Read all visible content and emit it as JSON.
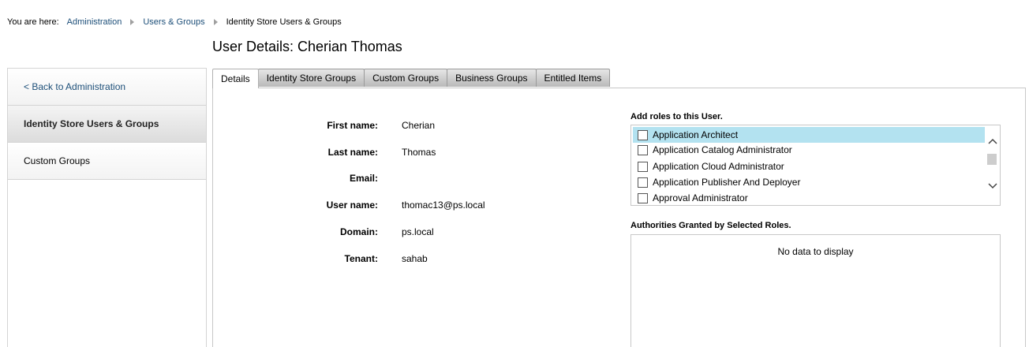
{
  "breadcrumb": {
    "prefix": "You are here:",
    "items": [
      "Administration",
      "Users & Groups"
    ],
    "current": "Identity Store Users & Groups"
  },
  "page_title": "User Details: Cherian Thomas",
  "sidebar": {
    "items": [
      {
        "label": "< Back to Administration"
      },
      {
        "label": "Identity Store Users & Groups"
      },
      {
        "label": "Custom Groups"
      }
    ]
  },
  "tabs": [
    "Details",
    "Identity Store Groups",
    "Custom Groups",
    "Business Groups",
    "Entitled Items"
  ],
  "details": {
    "fields": [
      {
        "label": "First name:",
        "value": "Cherian"
      },
      {
        "label": "Last name:",
        "value": "Thomas"
      },
      {
        "label": "Email:",
        "value": ""
      },
      {
        "label": "User name:",
        "value": "thomac13@ps.local"
      },
      {
        "label": "Domain:",
        "value": "ps.local"
      },
      {
        "label": "Tenant:",
        "value": "sahab"
      }
    ]
  },
  "roles": {
    "title": "Add roles to this User.",
    "items": [
      {
        "label": "Application Architect",
        "selected": true
      },
      {
        "label": "Application Catalog Administrator",
        "selected": false
      },
      {
        "label": "Application Cloud Administrator",
        "selected": false
      },
      {
        "label": "Application Publisher And Deployer",
        "selected": false
      },
      {
        "label": "Approval Administrator",
        "selected": false
      }
    ]
  },
  "authorities": {
    "title": "Authorities Granted by Selected Roles.",
    "empty_text": "No data to display"
  },
  "colors": {
    "link": "#1d4f79",
    "selected_row": "#b3e2f0"
  },
  "icons": [
    "breadcrumb-separator-icon",
    "chevron-up-icon",
    "chevron-down-icon"
  ]
}
